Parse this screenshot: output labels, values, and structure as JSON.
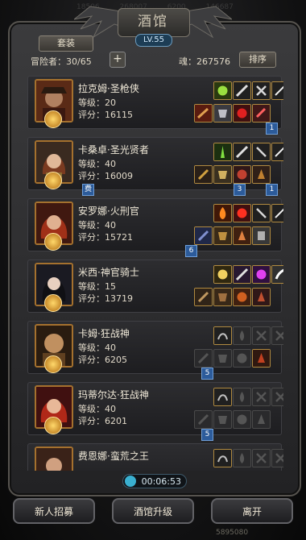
{
  "background_stats": [
    "18506",
    "268007",
    "6200",
    "146687"
  ],
  "header": {
    "title": "酒馆",
    "level": "LV.55",
    "tab_label": "套装",
    "adventurers_label": "冒险者：30/65",
    "add_label": "+",
    "soul_label": "魂：267576",
    "sort_label": "排序"
  },
  "heroes": [
    {
      "name": "拉克姆·圣枪侠",
      "level": "等级：20",
      "score": "评分：16115",
      "row1": [
        "filled",
        "filled",
        "filled",
        "filled"
      ],
      "row2": [
        "filled",
        "filled",
        "filled",
        "filled"
      ],
      "badge": "1"
    },
    {
      "name": "卡桑卓·圣光贤者",
      "level": "等级：40",
      "score": "评分：16009",
      "row1": [
        "filled",
        "filled",
        "filled",
        "filled"
      ],
      "row2": [
        "filled",
        "filled",
        "filled",
        "filled"
      ],
      "badges_below": [
        "费",
        "3",
        "1"
      ]
    },
    {
      "name": "安罗娜·火刑官",
      "level": "等级：40",
      "score": "评分：15721",
      "row1": [
        "filled",
        "filled",
        "filled",
        "filled"
      ],
      "row2": [
        "filled",
        "filled",
        "filled",
        "filled"
      ],
      "badge": "6"
    },
    {
      "name": "米西·神官骑士",
      "level": "等级：15",
      "score": "评分：13719",
      "row1": [
        "filled",
        "filled",
        "filled",
        "filled"
      ],
      "row2": [
        "filled",
        "filled",
        "filled",
        "filled"
      ]
    },
    {
      "name": "卡姆·狂战神",
      "level": "等级：40",
      "score": "评分：6205",
      "row1": [
        "filled",
        "empty",
        "empty",
        "empty"
      ],
      "row2": [
        "empty",
        "empty",
        "empty",
        "filled"
      ],
      "badge": "5"
    },
    {
      "name": "玛蒂尔达·狂战神",
      "level": "等级：40",
      "score": "评分：6201",
      "row1": [
        "filled",
        "empty",
        "empty",
        "empty"
      ],
      "row2": [
        "empty",
        "empty",
        "empty",
        "empty"
      ],
      "badge": "5"
    },
    {
      "name": "费恩娜·蛮荒之王",
      "level": "",
      "score": "",
      "row1": [
        "filled",
        "empty",
        "empty",
        "empty"
      ],
      "row2": []
    }
  ],
  "timer": "00:06:53",
  "buttons": {
    "recruit": "新人招募",
    "upgrade": "酒馆升级",
    "leave": "离开"
  },
  "gold": "5895080",
  "colors": {
    "accent_gold": "#b08a40",
    "badge_blue": "#2c5b9a"
  }
}
